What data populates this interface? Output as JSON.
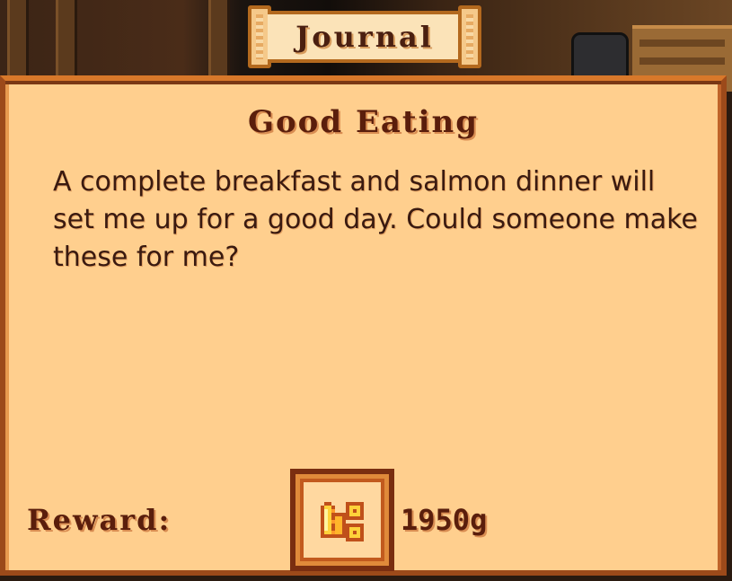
{
  "window": {
    "title": "Journal"
  },
  "quest": {
    "title": "Good Eating",
    "description": "A complete breakfast and salmon dinner will set me up for a good day. Could someone make these for me?"
  },
  "reward": {
    "label": "Reward:",
    "amount": "1950g",
    "icon": "gold-coins-icon"
  },
  "colors": {
    "panel_bg": "#ffcf8e",
    "border": "#9c4a1a",
    "title_text": "#5a1e0c",
    "body_text": "#3a1a10"
  }
}
